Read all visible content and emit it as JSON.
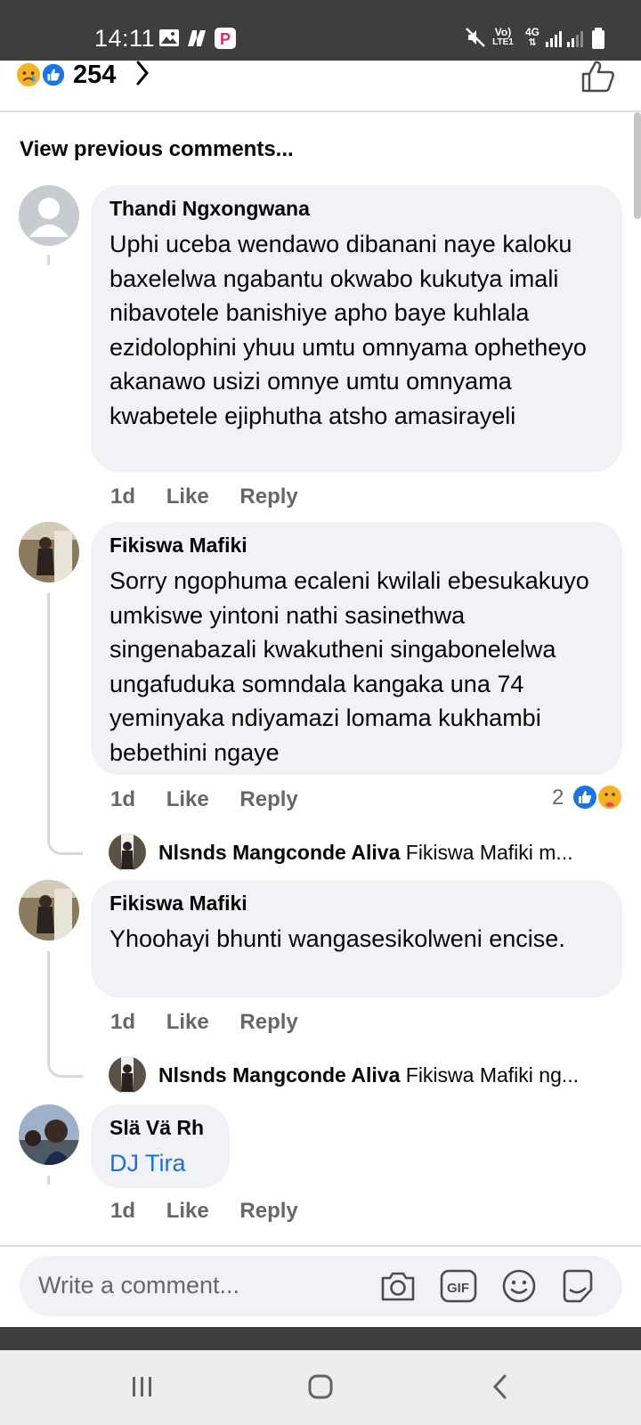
{
  "status_bar": {
    "time": "14:11",
    "volte": "Vo)",
    "lte": "LTE1",
    "network": "4G"
  },
  "reactions": {
    "count": "254"
  },
  "feed": {
    "view_previous": "View previous comments..."
  },
  "comments": [
    {
      "name": "Thandi Ngxongwana",
      "text": "Uphi uceba wendawo dibanani naye kaloku baxelelwa ngabantu okwabo kukutya imali nibavotele banishiye apho baye kuhlala ezidolophini yhuu umtu omnyama ophetheyo akanawo usizi omnye umtu omnyama kwabetele ejiphutha atsho amasirayeli",
      "time": "1d",
      "like": "Like",
      "reply": "Reply"
    },
    {
      "name": "Fikiswa Mafiki",
      "text": "Sorry ngophuma ecaleni kwilali ebesukakuyo umkiswe yintoni nathi sasinethwa singenabazali  kwakutheni singabonelelwa  ungafuduka somndala kangaka una 74 yeminyaka ndiyamazi lomama kukhambi bebethini ngaye",
      "time": "1d",
      "like": "Like",
      "reply": "Reply",
      "reaction_count": "2",
      "reply_preview": {
        "name": "Nlsnds Mangconde Aliva",
        "text": "Fikiswa Mafiki m..."
      }
    },
    {
      "name": "Fikiswa Mafiki",
      "text": "Yhoohayi bhunti wangasesikolweni encise.",
      "time": "1d",
      "like": "Like",
      "reply": "Reply",
      "reply_preview": {
        "name": "Nlsnds Mangconde Aliva",
        "text": "Fikiswa Mafiki ng..."
      }
    },
    {
      "name": "Slä Vä Rh",
      "text": "DJ Tira",
      "time": "1d",
      "like": "Like",
      "reply": "Reply"
    }
  ],
  "composer": {
    "placeholder": "Write a comment..."
  },
  "colors": {
    "status_bar": "#3e3e3e",
    "bubble": "#f0f2f5",
    "link": "#216fdb",
    "like_blue": "#1b74e4",
    "secondary_text": "#65676b"
  }
}
